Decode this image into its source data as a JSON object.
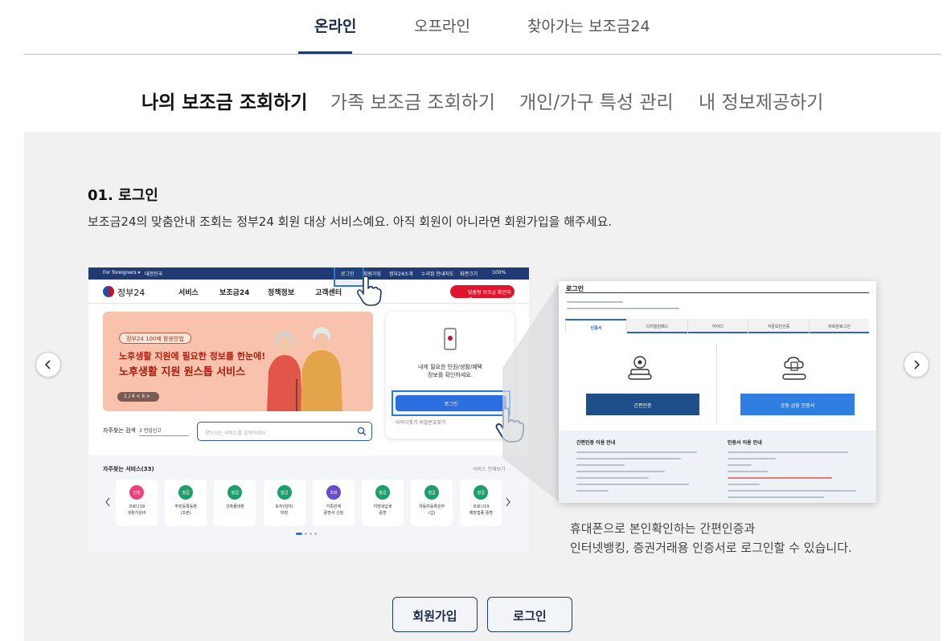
{
  "top_tabs": [
    "온라인",
    "오프라인",
    "찾아가는 보조금24"
  ],
  "sub_tabs": [
    "나의 보조금 조회하기",
    "가족 보조금 조회하기",
    "개인/가구 특성 관리",
    "내 정보제공하기"
  ],
  "step": {
    "title": "01. 로그인",
    "description": "보조금24의 맞춤안내 조회는 정부24 회원 대상 서비스예요. 아직 회원이 아니라면 회원가입을 해주세요."
  },
  "left_screenshot": {
    "topbar": [
      "For foreigners ▾",
      "대한민국",
      "로그인",
      "회원가입",
      "정부24소개",
      "누리집 안내지도",
      "화면크기",
      "100%"
    ],
    "logo": "정부24",
    "menu": [
      "서비스",
      "보조금24",
      "정책정보",
      "고객센터"
    ],
    "red_button": "맞춤형 보조금 확인하기 >",
    "banner": {
      "chip": "정부24 100배 활용방법",
      "line1": "노후생활 지원에 필요한 정보를 한눈에!",
      "line2": "노후생활 지원 원스톱 서비스",
      "pager": "1 / 4 < II >"
    },
    "card": {
      "text1": "내게 필요한 민원/생활/혜택",
      "text2": "정보를 확인하세요.",
      "button": "로그인",
      "links": "아이디찾기   비밀번호찾기"
    },
    "search": {
      "label": "자주찾는 검색",
      "select": "3 전입신고",
      "placeholder": "찾으시는 서비스를 입력하세요"
    },
    "services": {
      "title": "자주찾는 서비스(33)",
      "more": "서비스 전체보기",
      "items": [
        {
          "badge": "신청",
          "label": "코로나19\n생활지원비",
          "color": "#e8427c"
        },
        {
          "badge": "발급",
          "label": "주민등록등본\n(초본)",
          "color": "#1e9e6a"
        },
        {
          "badge": "발급",
          "label": "건축물대장",
          "color": "#1e9e6a"
        },
        {
          "badge": "발급",
          "label": "토지(임야)\n대장",
          "color": "#1e9e6a"
        },
        {
          "badge": "조회",
          "label": "가족관계\n증명서 신청",
          "color": "#6a4cc8"
        },
        {
          "badge": "발급",
          "label": "지방세납세\n증명",
          "color": "#1e9e6a"
        },
        {
          "badge": "발급",
          "label": "자동차등록원부\n(갑)",
          "color": "#1e9e6a"
        },
        {
          "badge": "발급",
          "label": "코로나19\n예방접종 증명",
          "color": "#1e9e6a"
        }
      ]
    }
  },
  "right_screenshot": {
    "title": "로그인",
    "tabs": [
      "인증서",
      "디지털원패스",
      "아이디",
      "지문보안인증",
      "비회원로그인"
    ],
    "button_simple": "간편인증",
    "button_cert": "공동·금융 인증서",
    "info_left": "간편인증 이용 안내",
    "info_right": "인증서 이용 안내"
  },
  "caption_lines": [
    "휴대폰으로 본인확인하는 간편인증과",
    "인터넷뱅킹, 증권거래용 인증서로 로그인할 수 있습니다."
  ],
  "buttons": {
    "signup": "회원가입",
    "login": "로그인"
  },
  "colors": {
    "navy": "#1d3b66",
    "panel_bg": "#f1f1f1",
    "blue": "#2c6de0",
    "red": "#e0142c"
  }
}
